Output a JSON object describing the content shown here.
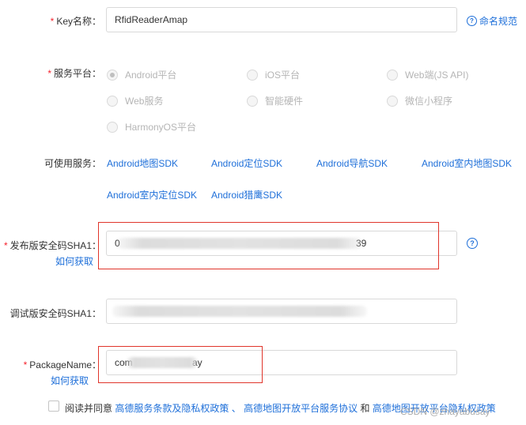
{
  "key_name": {
    "required": "*",
    "label": "Key名称：",
    "value": "RfidReaderAmap",
    "help_link": "命名规范"
  },
  "platform": {
    "required": "*",
    "label": "服务平台：",
    "options": [
      {
        "label": "Android平台",
        "selected": true
      },
      {
        "label": "iOS平台",
        "selected": false
      },
      {
        "label": "Web端(JS API)",
        "selected": false
      },
      {
        "label": "Web服务",
        "selected": false
      },
      {
        "label": "智能硬件",
        "selected": false
      },
      {
        "label": "微信小程序",
        "selected": false
      },
      {
        "label": "HarmonyOS平台",
        "selected": false
      }
    ]
  },
  "services": {
    "label": "可使用服务：",
    "items": [
      "Android地图SDK",
      "Android定位SDK",
      "Android导航SDK",
      "Android室内地图SDK",
      "Android室内定位SDK",
      "Android猎鹰SDK"
    ]
  },
  "release_sha1": {
    "required": "*",
    "label": "发布版安全码SHA1：",
    "value_start": "0",
    "value_end": "39",
    "help_link": "如何获取"
  },
  "debug_sha1": {
    "label": "调试版安全码SHA1："
  },
  "package_name": {
    "required": "*",
    "label": "PackageName：",
    "value_start": "com",
    "value_end": "ay",
    "help_link": "如何获取"
  },
  "agreement": {
    "prefix": "阅读并同意",
    "link1": "高德服务条款及隐私权政策",
    "sep1": "、",
    "link2": "高德地图开放平台服务协议",
    "sep2": "和",
    "link3": "高德地图开放平台隐私权政策"
  },
  "watermark": "CSDN @zhayabusay",
  "colors": {
    "link": "#1e6fd9",
    "required": "#f5222d",
    "highlight_box": "#e0352b"
  }
}
